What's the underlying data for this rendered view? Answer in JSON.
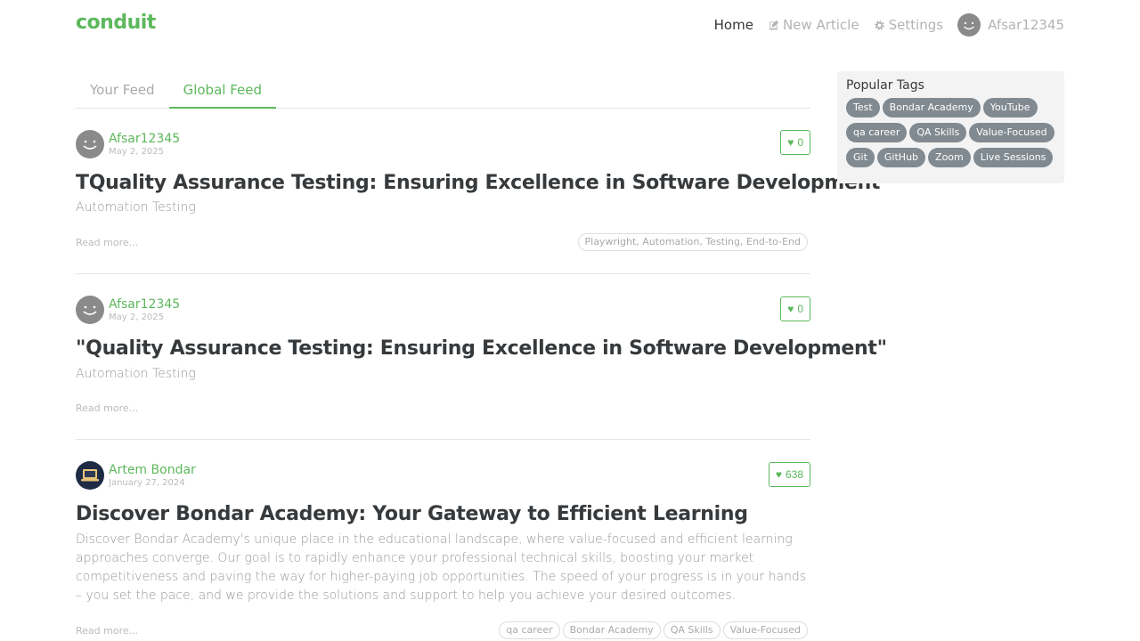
{
  "nav": {
    "brand": "conduit",
    "home": "Home",
    "new_article": "New Article",
    "settings": "Settings",
    "username": "Afsar12345"
  },
  "feed": {
    "tabs": [
      "Your Feed",
      "Global Feed"
    ],
    "active_tab": "Global Feed"
  },
  "articles": [
    {
      "author": "Afsar12345",
      "date": "May 2, 2025",
      "favorites": "0",
      "title": "TQuality Assurance Testing: Ensuring Excellence in Software Development",
      "description": "Automation Testing",
      "read_more": "Read more...",
      "tags": [
        "Playwright, Automation, Testing, End-to-End"
      ]
    },
    {
      "author": "Afsar12345",
      "date": "May 2, 2025",
      "favorites": "0",
      "title": "\"Quality Assurance Testing: Ensuring Excellence in Software Development\"",
      "description": "Automation Testing",
      "read_more": "Read more...",
      "tags": []
    },
    {
      "author": "Artem Bondar",
      "date": "January 27, 2024",
      "favorites": "638",
      "title": "Discover Bondar Academy: Your Gateway to Efficient Learning",
      "description": "Discover Bondar Academy's unique place in the educational landscape, where value-focused and efficient learning approaches converge. Our goal is to rapidly enhance your professional technical skills, boosting your market competitiveness and paving the way for higher-paying job opportunities. The speed of your progress is in your hands – you set the pace, and we provide the solutions and support to help you achieve your desired outcomes.",
      "read_more": "Read more...",
      "tags": [
        "qa career",
        "Bondar Academy",
        "QA Skills",
        "Value-Focused"
      ]
    }
  ],
  "sidebar": {
    "title": "Popular Tags",
    "tags": [
      "Test",
      "Bondar Academy",
      "YouTube",
      "qa career",
      "QA Skills",
      "Value-Focused",
      "Git",
      "GitHub",
      "Zoom",
      "Live Sessions"
    ]
  },
  "colors": {
    "accent": "#5cb85c",
    "tag_pill": "#818a91"
  }
}
